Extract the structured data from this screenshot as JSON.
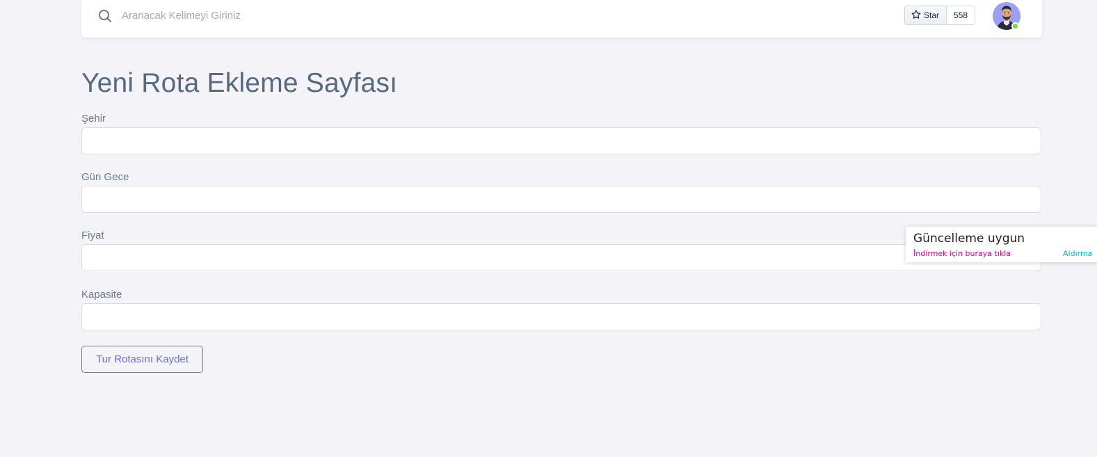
{
  "navbar": {
    "search": {
      "placeholder": "Aranacak Kelimeyi Giriniz",
      "value": "",
      "icon": "search-icon"
    },
    "github": {
      "star_label": "Star",
      "star_count": "558",
      "icon": "star-icon"
    },
    "user": {
      "avatar": "user-avatar",
      "status": "online",
      "status_color": "#71dd37"
    }
  },
  "page": {
    "title": "Yeni Rota Ekleme Sayfası"
  },
  "form": {
    "fields": [
      {
        "label": "Şehir",
        "value": ""
      },
      {
        "label": "Gün Gece",
        "value": ""
      },
      {
        "label": "Fiyat",
        "value": ""
      },
      {
        "label": "Kapasite",
        "value": ""
      }
    ],
    "submit_label": "Tur Rotasını Kaydet"
  },
  "notification": {
    "title": "Güncelleme uygun",
    "link": "İndirmek için buraya tıkla",
    "dismiss": "Aldırma"
  },
  "colors": {
    "primary": "#696cff",
    "background": "#f4f4f8",
    "heading": "#566a7f",
    "toast_link": "#e3008c",
    "toast_dismiss": "#00b7c3"
  }
}
